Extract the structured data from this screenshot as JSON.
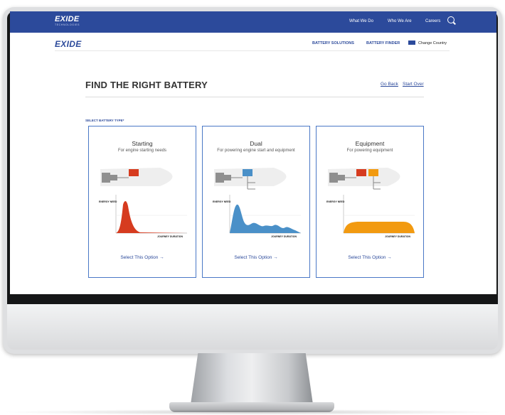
{
  "topbar": {
    "logo": "EXIDE",
    "logo_sub": "TECHNOLOGIES",
    "nav": [
      "What We Do",
      "Who We Are",
      "Careers"
    ]
  },
  "header": {
    "logo": "EXIDE",
    "nav": [
      "BATTERY SOLUTIONS",
      "BATTERY FINDER"
    ],
    "country": "Change Country"
  },
  "page": {
    "title": "FIND THE RIGHT BATTERY",
    "go_back": "Go Back",
    "start_over": "Start Over",
    "select_label": "SELECT BATTERY TYPE*"
  },
  "chart_labels": {
    "y": "ENERGY NEED",
    "x": "JOURNEY DURATION"
  },
  "cards": [
    {
      "title": "Starting",
      "subtitle": "For engine starting needs",
      "option": "Select This Option →",
      "color": "#d63b1f",
      "profile": "spike"
    },
    {
      "title": "Dual",
      "subtitle": "For powering engine start and equipment",
      "option": "Select This Option →",
      "color": "#4a90c8",
      "profile": "waves"
    },
    {
      "title": "Equipment",
      "subtitle": "For powering equipment",
      "option": "Select This Option →",
      "color": "#f29a10",
      "profile": "plateau"
    }
  ],
  "colors": {
    "brand_blue": "#2c4a9b",
    "card_border": "#4a78c6"
  }
}
